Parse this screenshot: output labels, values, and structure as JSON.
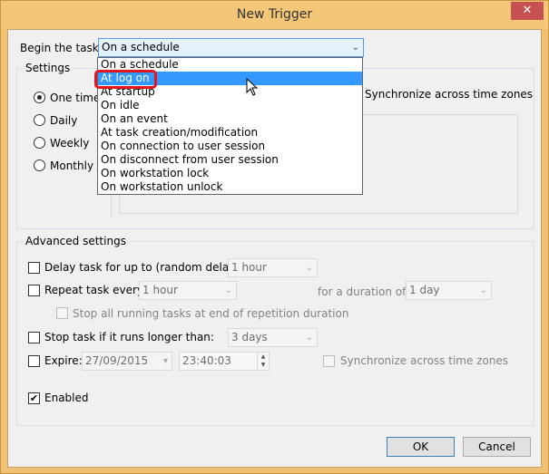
{
  "window": {
    "title": "New Trigger",
    "close_glyph": "✕"
  },
  "begin_task": {
    "label": "Begin the task:",
    "value": "On a schedule",
    "options": [
      "On a schedule",
      "At log on",
      "At startup",
      "On idle",
      "On an event",
      "At task creation/modification",
      "On connection to user session",
      "On disconnect from user session",
      "On workstation lock",
      "On workstation unlock"
    ],
    "hovered_option": "At log on"
  },
  "settings": {
    "title": "Settings",
    "schedule_options": [
      "One time",
      "Daily",
      "Weekly",
      "Monthly"
    ],
    "selected": "One time",
    "sync_label": "Synchronize across time zones"
  },
  "advanced": {
    "title": "Advanced settings",
    "delay_label": "Delay task for up to (random delay):",
    "delay_value": "1 hour",
    "repeat_label": "Repeat task every:",
    "repeat_value": "1 hour",
    "duration_label": "for a duration of:",
    "duration_value": "1 day",
    "stop_all_label": "Stop all running tasks at end of repetition duration",
    "stop_long_label": "Stop task if it runs longer than:",
    "stop_long_value": "3 days",
    "expire_label": "Expire:",
    "expire_date": "27/09/2015",
    "expire_time": "23:40:03",
    "expire_sync_label": "Synchronize across time zones",
    "enabled_label": "Enabled",
    "enabled_checked": true
  },
  "buttons": {
    "ok": "OK",
    "cancel": "Cancel"
  },
  "colors": {
    "title_bar": "#f3c777",
    "selection": "#3399ff",
    "annotation": "#e3161d"
  }
}
